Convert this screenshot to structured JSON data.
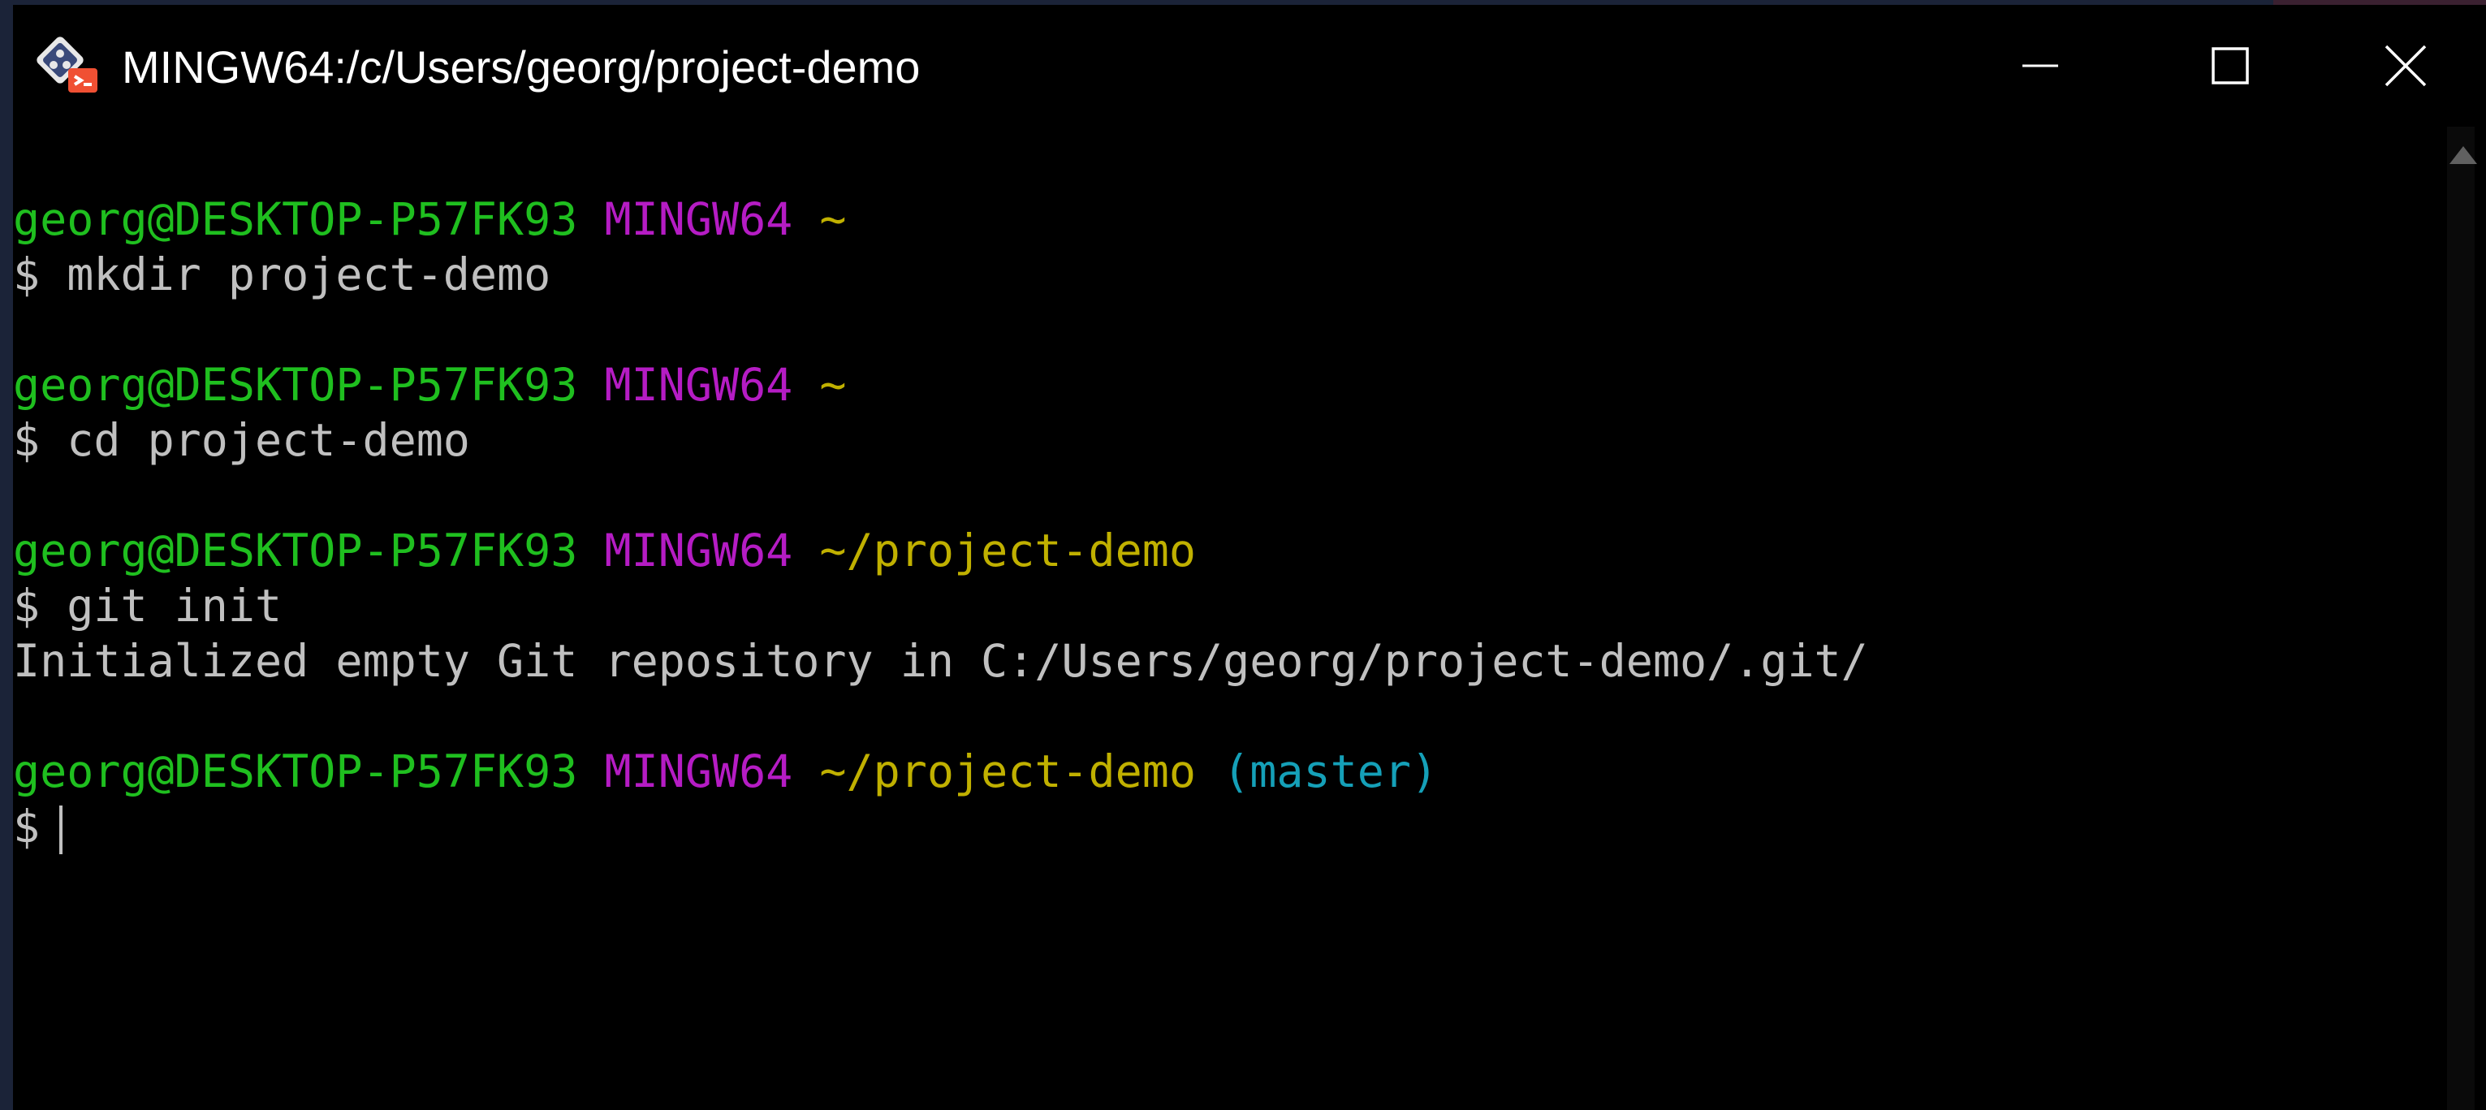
{
  "window": {
    "title": "MINGW64:/c/Users/georg/project-demo"
  },
  "terminal": {
    "lines": [
      {
        "user": "georg@DESKTOP-P57FK93",
        "system": "MINGW64",
        "path": "~",
        "branch": ""
      },
      {
        "command": "$ mkdir project-demo"
      },
      {
        "user": "georg@DESKTOP-P57FK93",
        "system": "MINGW64",
        "path": "~",
        "branch": ""
      },
      {
        "command": "$ cd project-demo"
      },
      {
        "user": "georg@DESKTOP-P57FK93",
        "system": "MINGW64",
        "path": "~/project-demo",
        "branch": ""
      },
      {
        "command": "$ git init"
      },
      {
        "output": "Initialized empty Git repository in C:/Users/georg/project-demo/.git/"
      },
      {
        "user": "georg@DESKTOP-P57FK93",
        "system": "MINGW64",
        "path": "~/project-demo",
        "branch": "(master)"
      },
      {
        "command": "$"
      }
    ]
  },
  "colors": {
    "user": "#1fbf1f",
    "system": "#b51cc4",
    "path": "#c0b000",
    "branch": "#15a0b8",
    "text": "#c0c0c0",
    "background": "#000000"
  },
  "icons": {
    "app": "git-bash-icon",
    "minimize": "minimize-icon",
    "maximize": "maximize-icon",
    "close": "close-icon",
    "scroll_up": "scroll-up-arrow-icon"
  }
}
